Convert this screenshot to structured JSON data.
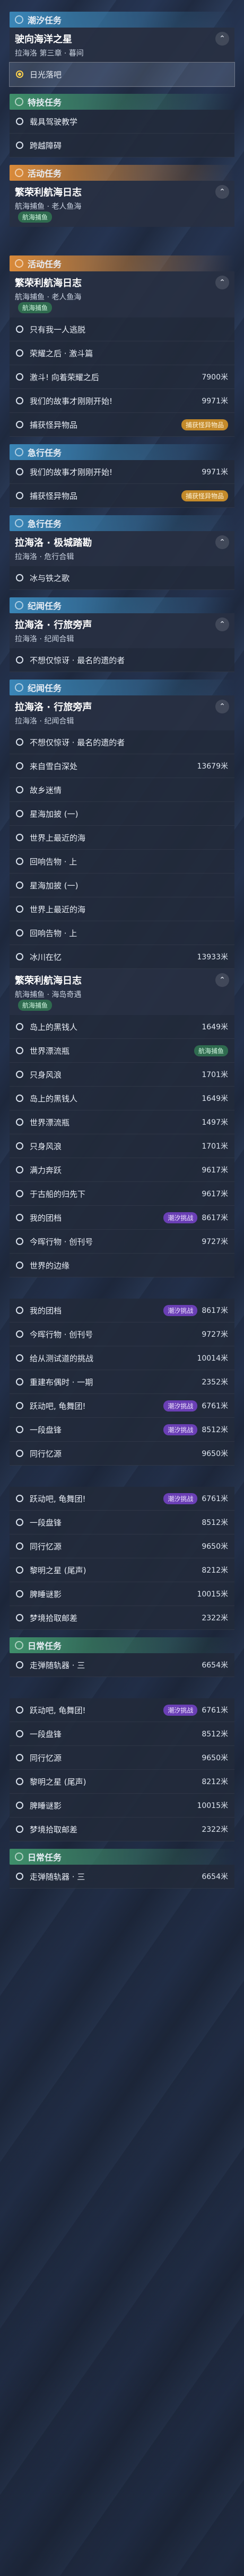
{
  "colors": {
    "orange": "#d98a3a",
    "blue": "#3a86b7",
    "green": "#3f8f6a",
    "purple": "#6a3fb5",
    "gold": "#c48a2a"
  },
  "sections": [
    {
      "type": "header",
      "name": "section-header-tide",
      "color": "#3a86b7",
      "label": "潮汐任务"
    },
    {
      "type": "title",
      "title": "驶向海洋之星",
      "subtitle": "拉海洛 第三章 · 暮间"
    },
    {
      "type": "items",
      "rows": [
        {
          "label": "日光落吧",
          "sel": true,
          "done": true
        }
      ]
    },
    {
      "type": "header",
      "name": "section-header-stunt",
      "color": "#3f8f6a",
      "label": "特技任务"
    },
    {
      "type": "items",
      "rows": [
        {
          "label": "载具驾驶教学"
        },
        {
          "label": "跨越障碍"
        }
      ]
    },
    {
      "type": "header",
      "name": "section-header-activity",
      "color": "#d98a3a",
      "label": "活动任务"
    },
    {
      "type": "title",
      "title": "繁荣利航海日志",
      "subtitle": "航海捕鱼 · 老人鱼海",
      "badge": "航海捕鱼",
      "badgeType": "green"
    },
    {
      "type": "gap"
    },
    {
      "type": "header",
      "name": "section-header-activity-2",
      "color": "#d98a3a",
      "label": "活动任务"
    },
    {
      "type": "title",
      "title": "繁荣利航海日志",
      "subtitle": "航海捕鱼 · 老人鱼海",
      "badge": "航海捕鱼",
      "badgeType": "green"
    },
    {
      "type": "items",
      "rows": [
        {
          "label": "只有我一人逃脱"
        },
        {
          "label": "荣耀之后 · 激斗篇"
        },
        {
          "label": "激斗! 向着荣耀之后",
          "val": "7900米"
        },
        {
          "label": "我们的故事才刚刚开始!",
          "val": "9971米"
        },
        {
          "label": "捕获怪异物品",
          "badge": "捕获怪异物品",
          "badgeType": "gold"
        }
      ]
    },
    {
      "type": "header",
      "name": "section-header-urgent",
      "color": "#3a86b7",
      "label": "急行任务"
    },
    {
      "type": "items",
      "rows": [
        {
          "label": "我们的故事才刚刚开始!",
          "val": "9971米"
        },
        {
          "label": "捕获怪异物品",
          "badge": "捕获怪异物品",
          "badgeType": "gold"
        }
      ]
    },
    {
      "type": "header",
      "name": "section-header-urgent-2",
      "color": "#3a86b7",
      "label": "急行任务"
    },
    {
      "type": "title",
      "title": "拉海洛 · 极城踏勘",
      "subtitle": "拉海洛 · 危行合辑"
    },
    {
      "type": "items",
      "rows": [
        {
          "label": "冰与铁之歌"
        }
      ]
    },
    {
      "type": "header",
      "name": "section-header-chronicle",
      "color": "#3a86b7",
      "label": "纪闻任务"
    },
    {
      "type": "title",
      "title": "拉海洛 · 行旅旁声",
      "subtitle": "拉海洛 · 纪闻合辑"
    },
    {
      "type": "items",
      "rows": [
        {
          "label": "不想仅惊讶 · 最名的遗的者"
        }
      ]
    },
    {
      "type": "header",
      "name": "section-header-chronicle-2",
      "color": "#3a86b7",
      "label": "纪闻任务"
    },
    {
      "type": "title",
      "title": "拉海洛 · 行旅旁声",
      "subtitle": "拉海洛 · 纪闻合辑"
    },
    {
      "type": "items",
      "rows": [
        {
          "label": "不想仅惊讶 · 最名的遗的者"
        },
        {
          "label": "来自雪白深处",
          "val": "13679米"
        },
        {
          "label": "故乡迷情"
        },
        {
          "label": "星海加披 (一)"
        },
        {
          "label": "世界上最近的海"
        },
        {
          "label": "回响告物 · 上"
        },
        {
          "label": "星海加披 (一)"
        },
        {
          "label": "世界上最近的海"
        },
        {
          "label": "回响告物 · 上"
        },
        {
          "label": "冰川在忆",
          "val": "13933米"
        }
      ]
    },
    {
      "type": "title",
      "title": "繁荣利航海日志",
      "subtitle": "航海捕鱼 · 海岛奇遇",
      "badge": "航海捕鱼",
      "badgeType": "green"
    },
    {
      "type": "items",
      "rows": [
        {
          "label": "岛上的黑钱人",
          "val": "1649米"
        },
        {
          "label": "世界漂流瓶",
          "badge": "航海捕鱼",
          "badgeType": "green"
        },
        {
          "label": "只身风浪",
          "val": "1701米"
        },
        {
          "label": "岛上的黑钱人",
          "val": "1649米"
        },
        {
          "label": "世界漂流瓶",
          "val": "1497米"
        },
        {
          "label": "只身风浪",
          "val": "1701米"
        },
        {
          "label": "满力奔跃",
          "val": "9617米"
        },
        {
          "label": "于古船的归先下",
          "val": "9617米"
        },
        {
          "label": "我的团档",
          "val": "8617米",
          "badge": "潮汐挑战",
          "badgeType": "purple"
        },
        {
          "label": "今晖行物 · 创刊号",
          "val": "9727米"
        },
        {
          "label": "世界的边缘"
        }
      ]
    },
    {
      "type": "gap"
    },
    {
      "type": "items",
      "rows": [
        {
          "label": "我的团档",
          "val": "8617米",
          "badge": "潮汐挑战",
          "badgeType": "purple"
        },
        {
          "label": "今晖行物 · 创刊号",
          "val": "9727米"
        },
        {
          "label": "给从测试道的挑战",
          "val": "10014米"
        },
        {
          "label": "重建布偶时 · 一期",
          "val": "2352米"
        },
        {
          "label": "跃动吧, 龟舞团!",
          "val": "6761米",
          "badge": "潮汐挑战",
          "badgeType": "purple"
        },
        {
          "label": "一段盘锋",
          "val": "8512米",
          "badge": "潮汐挑战",
          "badgeType": "purple"
        },
        {
          "label": "同行忆源",
          "val": "9650米"
        }
      ]
    },
    {
      "type": "gap"
    },
    {
      "type": "items",
      "rows": [
        {
          "label": "跃动吧, 龟舞团!",
          "val": "6761米",
          "badge": "潮汐挑战",
          "badgeType": "purple"
        },
        {
          "label": "一段盘锋",
          "val": "8512米"
        },
        {
          "label": "同行忆源",
          "val": "9650米"
        },
        {
          "label": "黎明之星 (尾声)",
          "val": "8212米"
        },
        {
          "label": "脾睡谜影",
          "val": "10015米"
        },
        {
          "label": "梦境拾取邮差",
          "val": "2322米"
        }
      ]
    },
    {
      "type": "header",
      "name": "section-header-daily",
      "color": "#3f8f6a",
      "label": "日常任务"
    },
    {
      "type": "items",
      "rows": [
        {
          "label": "走弹随轨器 · 三",
          "val": "6654米"
        }
      ]
    },
    {
      "type": "gap"
    },
    {
      "type": "items",
      "rows": [
        {
          "label": "跃动吧, 龟舞团!",
          "val": "6761米",
          "badge": "潮汐挑战",
          "badgeType": "purple"
        },
        {
          "label": "一段盘锋",
          "val": "8512米"
        },
        {
          "label": "同行忆源",
          "val": "9650米"
        },
        {
          "label": "黎明之星 (尾声)",
          "val": "8212米"
        },
        {
          "label": "脾睡谜影",
          "val": "10015米"
        },
        {
          "label": "梦境拾取邮差",
          "val": "2322米"
        }
      ]
    },
    {
      "type": "header",
      "name": "section-header-daily-2",
      "color": "#3f8f6a",
      "label": "日常任务"
    },
    {
      "type": "items",
      "rows": [
        {
          "label": "走弹随轨器 · 三",
          "val": "6654米"
        }
      ]
    }
  ]
}
